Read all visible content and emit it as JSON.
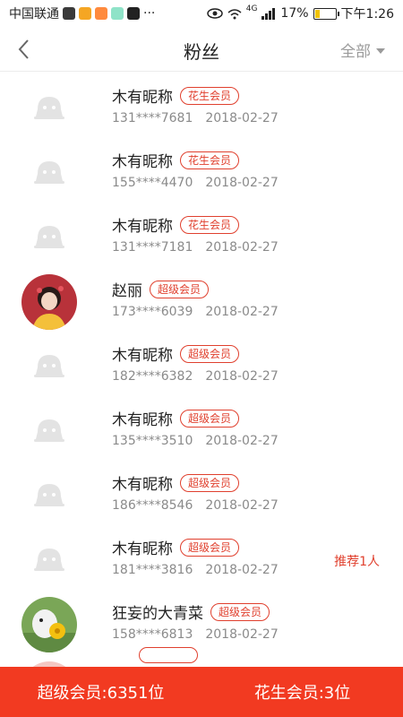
{
  "status_bar": {
    "carrier": "中国联通",
    "more": "···",
    "network": "4G",
    "battery_percent": "17%",
    "time": "下午1:26"
  },
  "header": {
    "title": "粉丝",
    "filter_label": "全部"
  },
  "fans": [
    {
      "name": "木有昵称",
      "badge": "花生会员",
      "phone": "131****7681",
      "date": "2018-02-27",
      "avatar": "default"
    },
    {
      "name": "木有昵称",
      "badge": "花生会员",
      "phone": "155****4470",
      "date": "2018-02-27",
      "avatar": "default"
    },
    {
      "name": "木有昵称",
      "badge": "花生会员",
      "phone": "131****7181",
      "date": "2018-02-27",
      "avatar": "default"
    },
    {
      "name": "赵丽",
      "badge": "超级会员",
      "phone": "173****6039",
      "date": "2018-02-27",
      "avatar": "photo-woman"
    },
    {
      "name": "木有昵称",
      "badge": "超级会员",
      "phone": "182****6382",
      "date": "2018-02-27",
      "avatar": "default"
    },
    {
      "name": "木有昵称",
      "badge": "超级会员",
      "phone": "135****3510",
      "date": "2018-02-27",
      "avatar": "default"
    },
    {
      "name": "木有昵称",
      "badge": "超级会员",
      "phone": "186****8546",
      "date": "2018-02-27",
      "avatar": "default"
    },
    {
      "name": "木有昵称",
      "badge": "超级会员",
      "phone": "181****3816",
      "date": "2018-02-27",
      "avatar": "default",
      "recommend": "推荐1人"
    },
    {
      "name": "狂妄的大青菜",
      "badge": "超级会员",
      "phone": "158****6813",
      "date": "2018-02-27",
      "avatar": "photo-dog"
    },
    {
      "name": "",
      "badge": "",
      "phone": "",
      "date": "",
      "avatar": "photo-partial"
    }
  ],
  "footer": {
    "super_members": "超级会员:6351位",
    "peanut_members": "花生会员:3位"
  },
  "colors": {
    "accent": "#f23a21",
    "badge": "#e0402e"
  }
}
